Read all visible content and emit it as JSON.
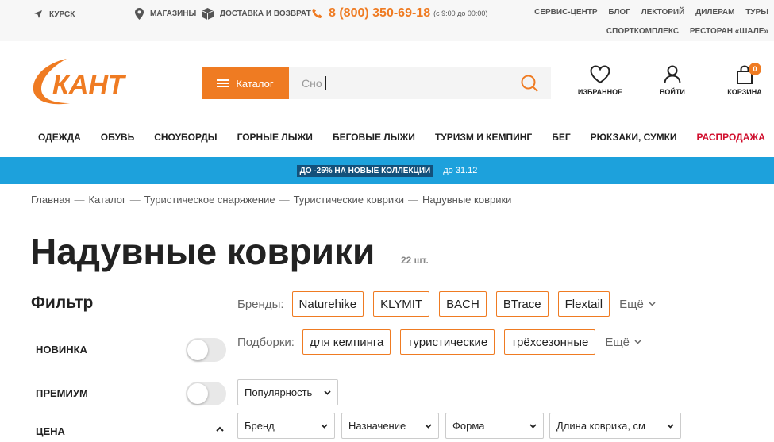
{
  "topbar": {
    "city": "КУРСК",
    "stores": "МАГАЗИНЫ",
    "delivery": "ДОСТАВКА И ВОЗВРАТ",
    "phone": "8 (800) 350-69-18",
    "hours": "(с 9:00 до 00:00)",
    "links_row1": [
      "СЕРВИС-ЦЕНТР",
      "БЛОГ",
      "ЛЕКТОРИЙ",
      "ДИЛЕРАМ",
      "ТУРЫ"
    ],
    "links_row2": [
      "СПОРТКОМПЛЕКС",
      "РЕСТОРАН «ШАЛЕ»"
    ]
  },
  "header": {
    "logo_text": "КАНТ",
    "catalog_label": "Каталог",
    "search_value": "Сно",
    "favorites_label": "ИЗБРАННОЕ",
    "login_label": "ВОЙТИ",
    "cart_label": "КОРЗИНА",
    "cart_count": "0"
  },
  "nav": {
    "items": [
      "ОДЕЖДА",
      "ОБУВЬ",
      "СНОУБОРДЫ",
      "ГОРНЫЕ ЛЫЖИ",
      "БЕГОВЫЕ ЛЫЖИ",
      "ТУРИЗМ И КЕМПИНГ",
      "БЕГ",
      "РЮКЗАКИ, СУМКИ"
    ],
    "sale": "РАСПРОДАЖА",
    "more": "···"
  },
  "promo": {
    "tag": "ДО -25% НА НОВЫЕ КОЛЛЕКЦИИ",
    "until": "до 31.12"
  },
  "breadcrumb": [
    "Главная",
    "Каталог",
    "Туристическое снаряжение",
    "Туристические коврики",
    "Надувные коврики"
  ],
  "breadcrumb_sep": "—",
  "page": {
    "title": "Надувные коврики",
    "count": "22 шт."
  },
  "filter": {
    "title": "Фильтр",
    "new_label": "НОВИНКА",
    "premium_label": "ПРЕМИУМ",
    "price_label": "ЦЕНА"
  },
  "brands": {
    "label": "Бренды:",
    "items": [
      "Naturehike",
      "KLYMIT",
      "BACH",
      "BTrace",
      "Flextail"
    ],
    "more": "Ещё"
  },
  "collections": {
    "label": "Подборки:",
    "items": [
      "для кемпинга",
      "туристические",
      "трёхсезонные"
    ],
    "more": "Ещё"
  },
  "sort": {
    "value": "Популярность"
  },
  "dropdowns": [
    "Бренд",
    "Назначение",
    "Форма",
    "Длина коврика, см"
  ],
  "colors": {
    "accent": "#ef7b22",
    "promo_bg": "#1da1dc",
    "sale": "#d10f2e"
  }
}
